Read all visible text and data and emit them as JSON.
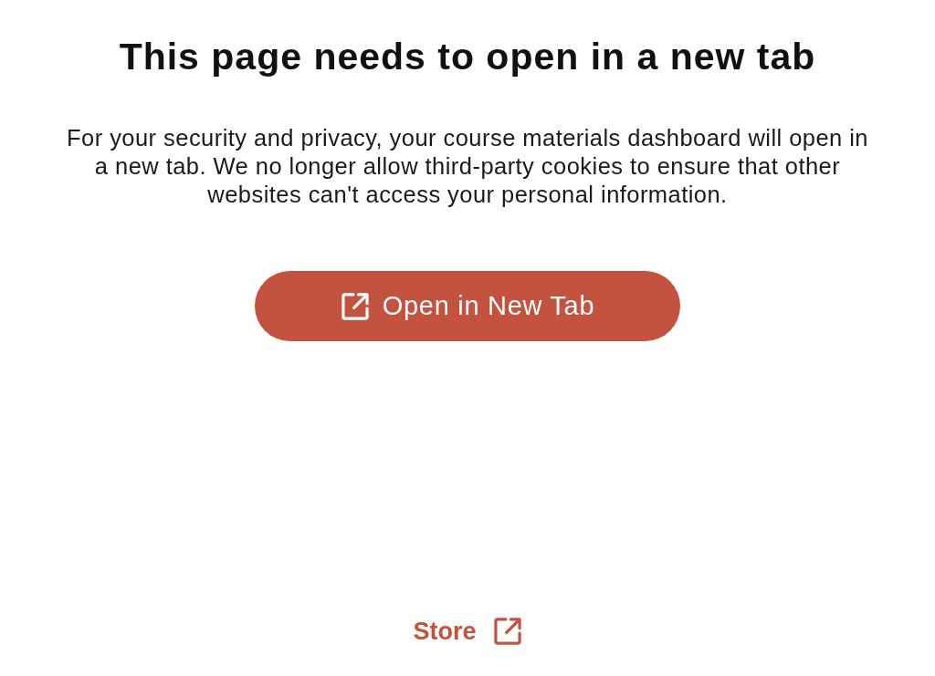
{
  "heading": "This page needs to open in a new tab",
  "message_lines": [
    "For your security and privacy, your course materials dashboard will open in",
    "a new tab. We no longer allow third-party cookies to ensure that other",
    "websites can't access your personal information."
  ],
  "primary_button": {
    "label": "Open in New Tab"
  },
  "footer_link": {
    "label": "Store"
  }
}
